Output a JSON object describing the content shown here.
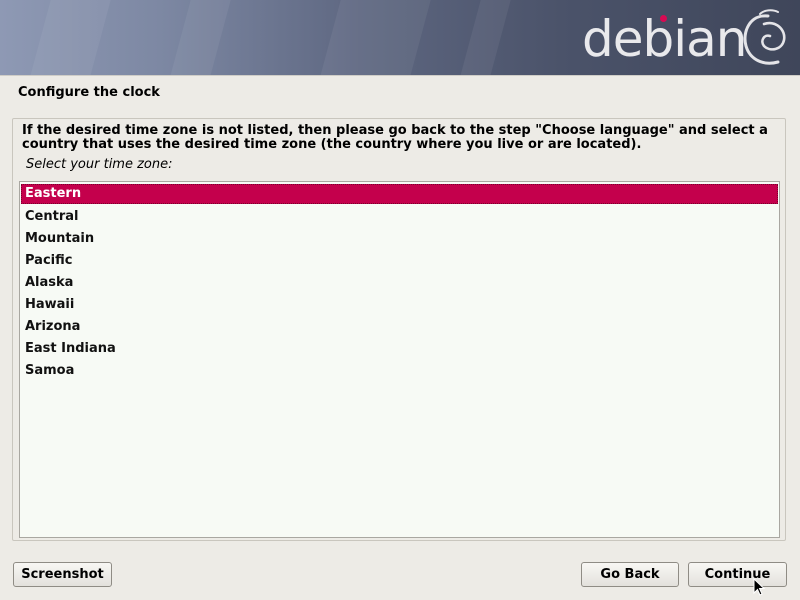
{
  "banner": {
    "logo_text": "debian",
    "logo_accent_color": "#d70a53",
    "logo_icon": "debian-swirl-icon"
  },
  "page": {
    "title": "Configure the clock",
    "help_text": "If the desired time zone is not listed, then please go back to the step \"Choose language\" and select a country that uses the desired time zone (the country where you live or are located).",
    "prompt": "Select your time zone:"
  },
  "timezones": {
    "selected": "Eastern",
    "items": [
      {
        "label": "Eastern"
      },
      {
        "label": "Central"
      },
      {
        "label": "Mountain"
      },
      {
        "label": "Pacific"
      },
      {
        "label": "Alaska"
      },
      {
        "label": "Hawaii"
      },
      {
        "label": "Arizona"
      },
      {
        "label": "East Indiana"
      },
      {
        "label": "Samoa"
      }
    ]
  },
  "buttons": {
    "screenshot": "Screenshot",
    "go_back": "Go Back",
    "continue": "Continue"
  },
  "colors": {
    "selection": "#c4004c",
    "background": "#edebe6",
    "list_background": "#f7faf5"
  }
}
